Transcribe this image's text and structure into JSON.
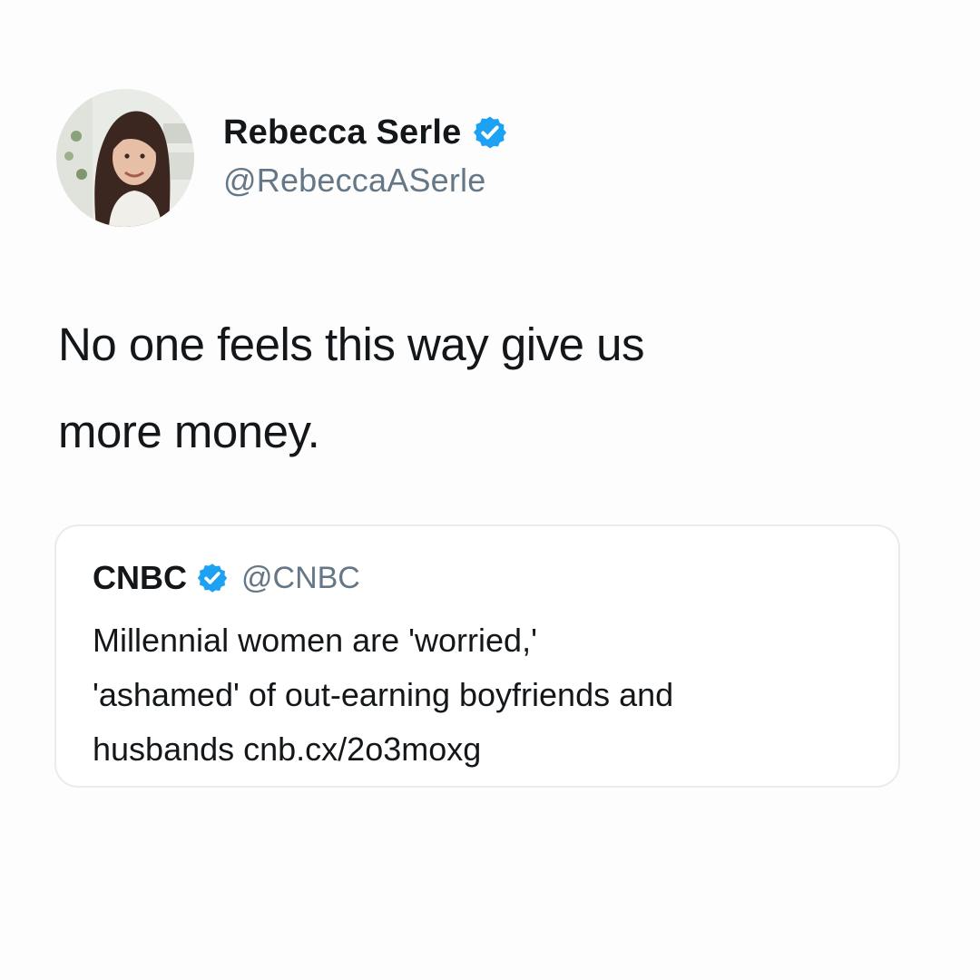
{
  "tweet": {
    "display_name": "Rebecca Serle",
    "handle": "@RebeccaASerle",
    "verified": true,
    "text_line_1": "No one feels this way give us",
    "text_line_2": "more money."
  },
  "quoted_tweet": {
    "display_name": "CNBC",
    "handle": "@CNBC",
    "verified": true,
    "text_line_1": "Millennial women are 'worried,'",
    "text_line_2": "'ashamed' of out-earning boyfriends and",
    "text_line_3": "husbands cnb.cx/2o3moxg"
  },
  "colors": {
    "background": "#fdfdfd",
    "primary_text": "#14171a",
    "secondary_text": "#657786",
    "verified_badge": "#1da1f2",
    "card_border": "#e6ecf0"
  },
  "icons": {
    "verified": "verified-badge-icon",
    "avatar": "profile-photo"
  }
}
